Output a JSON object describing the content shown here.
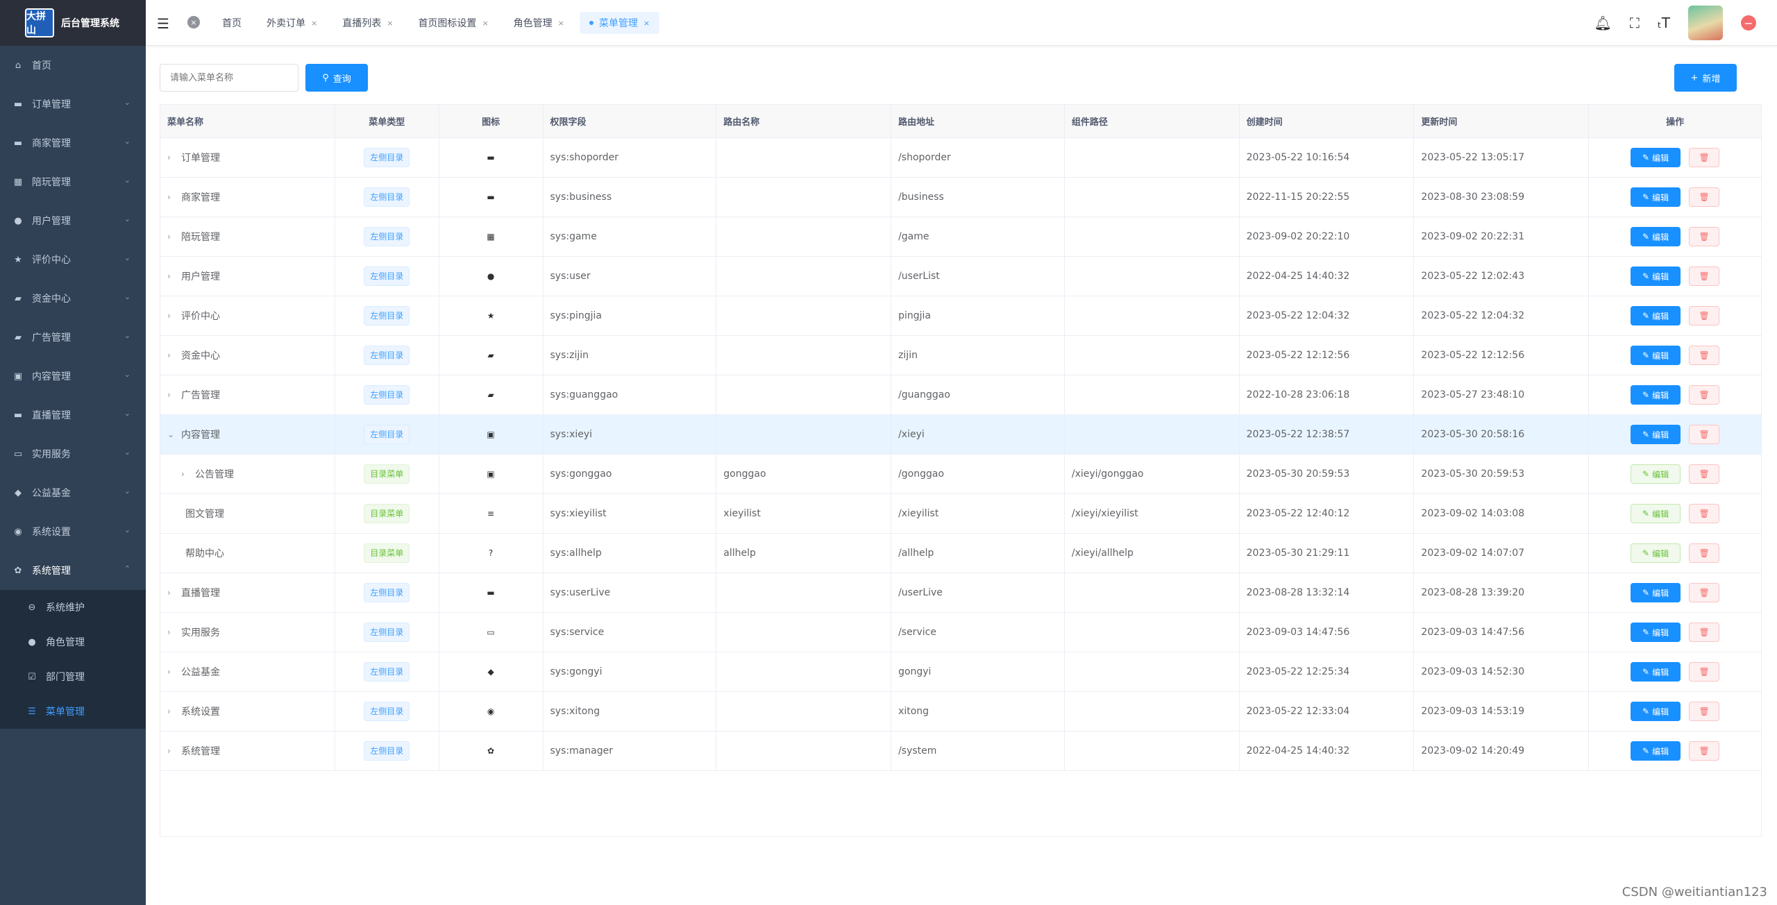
{
  "app": {
    "logo_text": "大拼山",
    "title": "后台管理系统"
  },
  "sidebar": {
    "items": [
      {
        "label": "首页",
        "icon": "home-icon",
        "glyph": "⌂"
      },
      {
        "label": "订单管理",
        "icon": "monitor-icon",
        "glyph": "▬"
      },
      {
        "label": "商家管理",
        "icon": "shop-icon",
        "glyph": "▬"
      },
      {
        "label": "陪玩管理",
        "icon": "grid-icon",
        "glyph": "▦"
      },
      {
        "label": "用户管理",
        "icon": "user-icon",
        "glyph": "●"
      },
      {
        "label": "评价中心",
        "icon": "star-icon",
        "glyph": "★"
      },
      {
        "label": "资金中心",
        "icon": "money-icon",
        "glyph": "▰"
      },
      {
        "label": "广告管理",
        "icon": "ad-icon",
        "glyph": "▰"
      },
      {
        "label": "内容管理",
        "icon": "clipboard-icon",
        "glyph": "▣"
      },
      {
        "label": "直播管理",
        "icon": "live-icon",
        "glyph": "▬"
      },
      {
        "label": "实用服务",
        "icon": "toolbox-icon",
        "glyph": "▭"
      },
      {
        "label": "公益基金",
        "icon": "leaf-icon",
        "glyph": "◆"
      },
      {
        "label": "系统设置",
        "icon": "settings-circle-icon",
        "glyph": "◉"
      },
      {
        "label": "系统管理",
        "icon": "gear-icon",
        "glyph": "✿"
      }
    ],
    "sub_items": [
      {
        "label": "系统维护",
        "icon": "minus-circle-icon",
        "glyph": "⊖"
      },
      {
        "label": "角色管理",
        "icon": "user-icon",
        "glyph": "●"
      },
      {
        "label": "部门管理",
        "icon": "checkbox-icon",
        "glyph": "☑"
      },
      {
        "label": "菜单管理",
        "icon": "list-icon",
        "glyph": "☰"
      }
    ]
  },
  "header": {
    "tabs": [
      {
        "label": "首页"
      },
      {
        "label": "外卖订单"
      },
      {
        "label": "直播列表"
      },
      {
        "label": "首页图标设置"
      },
      {
        "label": "角色管理"
      },
      {
        "label": "菜单管理"
      }
    ],
    "close_glyph": "×"
  },
  "toolbar": {
    "search_placeholder": "请输入菜单名称",
    "query_label": "查询",
    "add_label": "新增"
  },
  "table": {
    "headers": [
      "菜单名称",
      "菜单类型",
      "图标",
      "权限字段",
      "路由名称",
      "路由地址",
      "组件路径",
      "创建时间",
      "更新时间",
      "操作"
    ],
    "edit_label": "编辑",
    "rows": [
      {
        "name": "订单管理",
        "type": "左侧目录",
        "icon": "▬",
        "perm": "sys:shoporder",
        "route": "",
        "path": "/shoporder",
        "comp": "",
        "created": "2023-05-22 10:16:54",
        "updated": "2023-05-22 13:05:17",
        "exp": "›"
      },
      {
        "name": "商家管理",
        "type": "左侧目录",
        "icon": "▬",
        "perm": "sys:business",
        "route": "",
        "path": "/business",
        "comp": "",
        "created": "2022-11-15 20:22:55",
        "updated": "2023-08-30 23:08:59",
        "exp": "›"
      },
      {
        "name": "陪玩管理",
        "type": "左侧目录",
        "icon": "▦",
        "perm": "sys:game",
        "route": "",
        "path": "/game",
        "comp": "",
        "created": "2023-09-02 20:22:10",
        "updated": "2023-09-02 20:22:31",
        "exp": "›"
      },
      {
        "name": "用户管理",
        "type": "左侧目录",
        "icon": "●",
        "perm": "sys:user",
        "route": "",
        "path": "/userList",
        "comp": "",
        "created": "2022-04-25 14:40:32",
        "updated": "2023-05-22 12:02:43",
        "exp": "›"
      },
      {
        "name": "评价中心",
        "type": "左侧目录",
        "icon": "★",
        "perm": "sys:pingjia",
        "route": "",
        "path": "pingjia",
        "comp": "",
        "created": "2023-05-22 12:04:32",
        "updated": "2023-05-22 12:04:32",
        "exp": "›"
      },
      {
        "name": "资金中心",
        "type": "左侧目录",
        "icon": "▰",
        "perm": "sys:zijin",
        "route": "",
        "path": "zijin",
        "comp": "",
        "created": "2023-05-22 12:12:56",
        "updated": "2023-05-22 12:12:56",
        "exp": "›"
      },
      {
        "name": "广告管理",
        "type": "左侧目录",
        "icon": "▰",
        "perm": "sys:guanggao",
        "route": "",
        "path": "/guanggao",
        "comp": "",
        "created": "2022-10-28 23:06:18",
        "updated": "2023-05-27 23:48:10",
        "exp": "›"
      },
      {
        "name": "内容管理",
        "type": "左侧目录",
        "icon": "▣",
        "perm": "sys:xieyi",
        "route": "",
        "path": "/xieyi",
        "comp": "",
        "created": "2023-05-22 12:38:57",
        "updated": "2023-05-30 20:58:16",
        "exp": "⌄"
      },
      {
        "name": "公告管理",
        "type": "目录菜单",
        "icon": "▣",
        "perm": "sys:gonggao",
        "route": "gonggao",
        "path": "/gonggao",
        "comp": "/xieyi/gonggao",
        "created": "2023-05-30 20:59:53",
        "updated": "2023-05-30 20:59:53",
        "exp": "›"
      },
      {
        "name": "图文管理",
        "type": "目录菜单",
        "icon": "≡",
        "perm": "sys:xieyilist",
        "route": "xieyilist",
        "path": "/xieyilist",
        "comp": "/xieyi/xieyilist",
        "created": "2023-05-22 12:40:12",
        "updated": "2023-09-02 14:03:08",
        "exp": ""
      },
      {
        "name": "帮助中心",
        "type": "目录菜单",
        "icon": "?",
        "perm": "sys:allhelp",
        "route": "allhelp",
        "path": "/allhelp",
        "comp": "/xieyi/allhelp",
        "created": "2023-05-30 21:29:11",
        "updated": "2023-09-02 14:07:07",
        "exp": ""
      },
      {
        "name": "直播管理",
        "type": "左侧目录",
        "icon": "▬",
        "perm": "sys:userLive",
        "route": "",
        "path": "/userLive",
        "comp": "",
        "created": "2023-08-28 13:32:14",
        "updated": "2023-08-28 13:39:20",
        "exp": "›"
      },
      {
        "name": "实用服务",
        "type": "左侧目录",
        "icon": "▭",
        "perm": "sys:service",
        "route": "",
        "path": "/service",
        "comp": "",
        "created": "2023-09-03 14:47:56",
        "updated": "2023-09-03 14:47:56",
        "exp": "›"
      },
      {
        "name": "公益基金",
        "type": "左侧目录",
        "icon": "◆",
        "perm": "sys:gongyi",
        "route": "",
        "path": "gongyi",
        "comp": "",
        "created": "2023-05-22 12:25:34",
        "updated": "2023-09-03 14:52:30",
        "exp": "›"
      },
      {
        "name": "系统设置",
        "type": "左侧目录",
        "icon": "◉",
        "perm": "sys:xitong",
        "route": "",
        "path": "xitong",
        "comp": "",
        "created": "2023-05-22 12:33:04",
        "updated": "2023-09-03 14:53:19",
        "exp": "›"
      },
      {
        "name": "系统管理",
        "type": "左侧目录",
        "icon": "✿",
        "perm": "sys:manager",
        "route": "",
        "path": "/system",
        "comp": "",
        "created": "2022-04-25 14:40:32",
        "updated": "2023-09-02 14:20:49",
        "exp": "›"
      }
    ]
  },
  "watermark": "CSDN @weitiantian123",
  "colors": {
    "sidebar_bg": "#304156",
    "primary": "#1890ff",
    "danger": "#f56c6c",
    "success": "#67c23a"
  }
}
